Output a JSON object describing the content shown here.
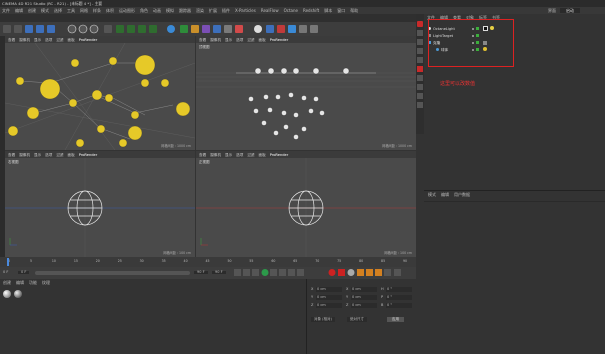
{
  "window": {
    "title": "CINEMA 4D R21 Studio (RC - R21) - [未标题 4 *] - 主要"
  },
  "menubar": {
    "items": [
      "文件",
      "编辑",
      "创建",
      "模式",
      "选择",
      "工具",
      "网格",
      "样条",
      "体积",
      "运动图形",
      "角色",
      "动画",
      "模拟",
      "跟踪器",
      "渲染",
      "扩展",
      "插件",
      "X-Particles",
      "RealFlow",
      "Octane",
      "Redshift",
      "脚本",
      "窗口",
      "帮助"
    ]
  },
  "layout_label": "界面",
  "layout_value": "启动",
  "viewport_top_left": {
    "menu": [
      "查看",
      "摄像机",
      "显示",
      "选项",
      "过滤",
      "面板",
      "ProRender"
    ],
    "label": "",
    "grid": "网格间距 : 1000 cm"
  },
  "viewport_top_right": {
    "menu": [
      "查看",
      "摄像机",
      "显示",
      "选项",
      "过滤",
      "面板",
      "ProRender"
    ],
    "label": "顶视图",
    "grid": "网格间距 : 1000 cm"
  },
  "viewport_bottom_left": {
    "menu": [
      "查看",
      "摄像机",
      "显示",
      "选项",
      "过滤",
      "面板",
      "ProRender"
    ],
    "label": "右视图",
    "grid": "网格间距 : 100 cm"
  },
  "viewport_bottom_right": {
    "menu": [
      "查看",
      "摄像机",
      "显示",
      "选项",
      "过滤",
      "面板",
      "ProRender"
    ],
    "label": "正视图",
    "grid": "网格间距 : 100 cm"
  },
  "object_manager": {
    "menu": [
      "文件",
      "编辑",
      "查看",
      "对象",
      "标签",
      "书签"
    ],
    "rows": [
      {
        "name": "OctaneLight",
        "indent": 0
      },
      {
        "name": "LightTarget",
        "indent": 0
      },
      {
        "name": "克隆",
        "indent": 0
      },
      {
        "name": "球体",
        "indent": 1
      }
    ],
    "annotation": "这里可以改数值"
  },
  "attributes": {
    "tabs": [
      "模式",
      "编辑",
      "用户数据"
    ]
  },
  "timeline": {
    "ticks": [
      "0",
      "5",
      "10",
      "15",
      "20",
      "25",
      "30",
      "35",
      "40",
      "45",
      "50",
      "55",
      "60",
      "65",
      "70",
      "75",
      "80",
      "85",
      "90"
    ],
    "current_frame": "0 F",
    "start": "0 F",
    "end": "90 F",
    "end2": "90 F"
  },
  "materials": {
    "menu": [
      "创建",
      "编辑",
      "功能",
      "纹理"
    ]
  },
  "coords": {
    "rows": [
      {
        "axis": "X",
        "pos": "0 cm",
        "axis2": "X",
        "size": "0 cm",
        "axis3": "H",
        "rot": "0 °"
      },
      {
        "axis": "Y",
        "pos": "0 cm",
        "axis2": "Y",
        "size": "0 cm",
        "axis3": "P",
        "rot": "0 °"
      },
      {
        "axis": "Z",
        "pos": "0 cm",
        "axis2": "Z",
        "size": "0 cm",
        "axis3": "B",
        "rot": "0 °"
      }
    ],
    "mode": "对象 (相对)",
    "size_mode": "绝对尺寸",
    "apply": "应用"
  }
}
